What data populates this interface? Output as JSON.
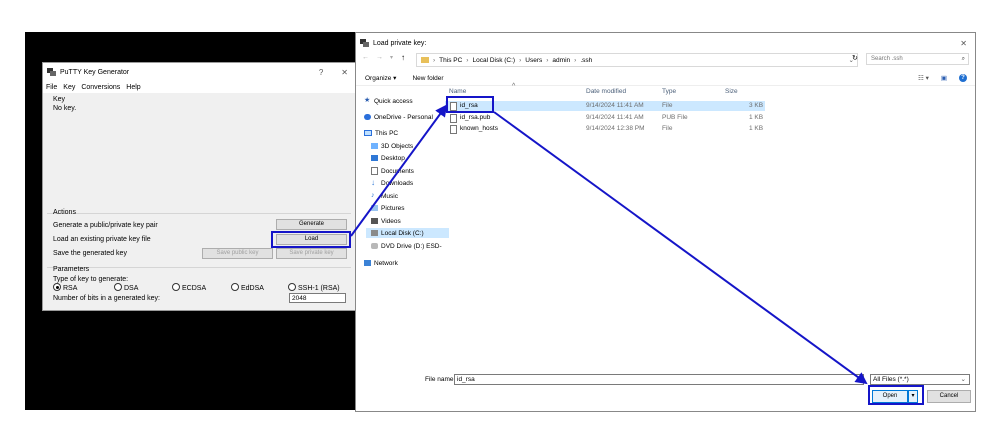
{
  "putty": {
    "title": "PuTTY Key Generator",
    "help_glyph": "?",
    "close_glyph": "✕",
    "menu": [
      "File",
      "Key",
      "Conversions",
      "Help"
    ],
    "key_label": "Key",
    "key_value": "No key.",
    "actions_label": "Actions",
    "generate_text": "Generate a public/private key pair",
    "generate_btn": "Generate",
    "load_text": "Load an existing private key file",
    "load_btn": "Load",
    "save_text": "Save the generated key",
    "save_public_btn": "Save public key",
    "save_private_btn": "Save private key",
    "parameters_label": "Parameters",
    "type_label": "Type of key to generate:",
    "key_types": [
      "RSA",
      "DSA",
      "ECDSA",
      "EdDSA",
      "SSH-1 (RSA)"
    ],
    "selected_type": "RSA",
    "bits_label": "Number of bits in a generated key:",
    "bits_value": "2048"
  },
  "explorer": {
    "title": "Load private key:",
    "close_glyph": "✕",
    "path": [
      "This PC",
      "Local Disk (C:)",
      "Users",
      "admin",
      ".ssh"
    ],
    "search_placeholder": "Search .ssh",
    "organize": "Organize ▾",
    "new_folder": "New folder",
    "nav": [
      {
        "label": "Quick access",
        "icon": "star-icon"
      },
      {
        "label": "OneDrive - Personal",
        "icon": "cloud-icon"
      },
      {
        "label": "This PC",
        "icon": "computer-icon"
      },
      {
        "label": "3D Objects",
        "icon": "cube-icon"
      },
      {
        "label": "Desktop",
        "icon": "desktop-icon"
      },
      {
        "label": "Documents",
        "icon": "document-icon"
      },
      {
        "label": "Downloads",
        "icon": "download-icon"
      },
      {
        "label": "Music",
        "icon": "music-icon"
      },
      {
        "label": "Pictures",
        "icon": "pictures-icon"
      },
      {
        "label": "Videos",
        "icon": "video-icon"
      },
      {
        "label": "Local Disk (C:)",
        "icon": "disk-icon"
      },
      {
        "label": "DVD Drive (D:) ESD-",
        "icon": "dvd-icon"
      },
      {
        "label": "Network",
        "icon": "network-icon"
      }
    ],
    "columns": [
      "Name",
      "Date modified",
      "Type",
      "Size"
    ],
    "files": [
      {
        "name": "id_rsa",
        "date": "9/14/2024 11:41 AM",
        "type": "File",
        "size": "3 KB"
      },
      {
        "name": "id_rsa.pub",
        "date": "9/14/2024 11:41 AM",
        "type": "PUB File",
        "size": "1 KB"
      },
      {
        "name": "known_hosts",
        "date": "9/14/2024 12:38 PM",
        "type": "File",
        "size": "1 KB"
      }
    ],
    "filename_label": "File name:",
    "filename_value": "id_rsa",
    "filetype_value": "All Files (*.*)",
    "open_btn": "Open",
    "cancel_btn": "Cancel"
  },
  "colors": {
    "annotation": "#1515c8",
    "selection": "#cce8ff"
  }
}
